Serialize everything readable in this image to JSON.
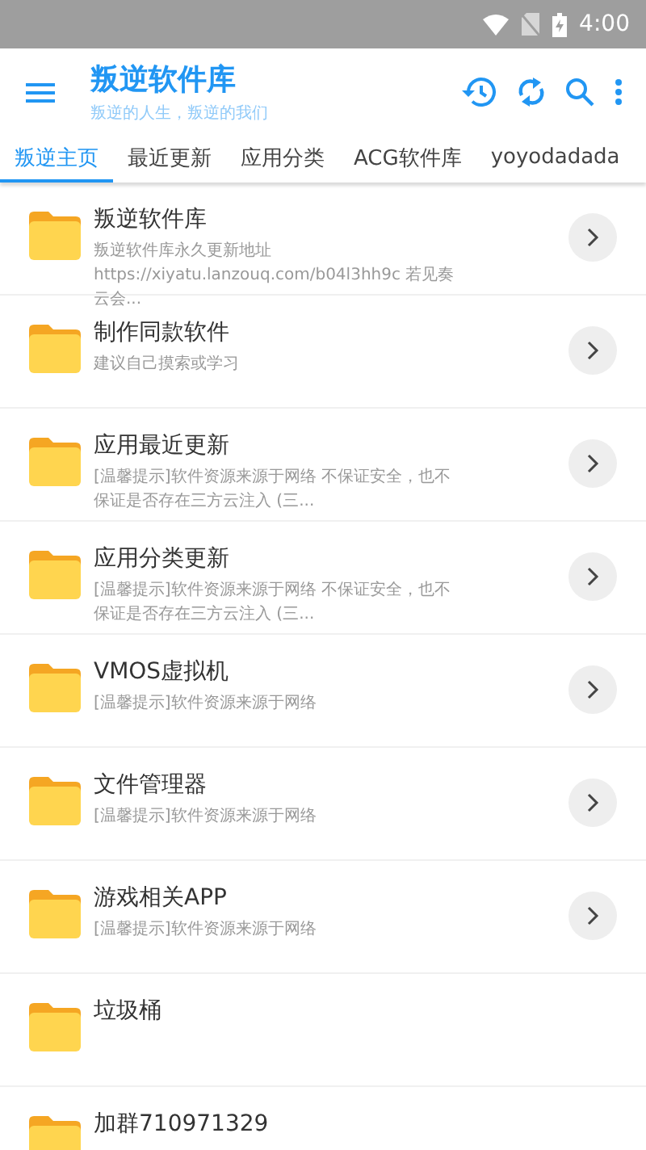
{
  "status_bar": {
    "time": "4:00"
  },
  "app_bar": {
    "title": "叛逆软件库",
    "subtitle": "叛逆的人生，叛逆的我们"
  },
  "tabs": [
    {
      "label": "叛逆主页",
      "selected": true
    },
    {
      "label": "最近更新",
      "selected": false
    },
    {
      "label": "应用分类",
      "selected": false
    },
    {
      "label": "ACG软件库",
      "selected": false
    },
    {
      "label": "yoyodadada",
      "selected": false
    }
  ],
  "items": [
    {
      "title": "叛逆软件库",
      "description": "叛逆软件库永久更新地址\nhttps://xiyatu.lanzouq.com/b04l3hh9c 若见奏云会...",
      "arrow": true
    },
    {
      "title": "制作同款软件",
      "description": "建议自己摸索或学习",
      "arrow": true
    },
    {
      "title": "应用最近更新",
      "description": "[温馨提示]软件资源来源于网络 不保证安全，也不保证是否存在三方云注入 (三...",
      "arrow": true
    },
    {
      "title": "应用分类更新",
      "description": "[温馨提示]软件资源来源于网络 不保证安全，也不保证是否存在三方云注入 (三...",
      "arrow": true
    },
    {
      "title": "VMOS虚拟机",
      "description": "[温馨提示]软件资源来源于网络",
      "arrow": true
    },
    {
      "title": "文件管理器",
      "description": "[温馨提示]软件资源来源于网络",
      "arrow": true
    },
    {
      "title": "游戏相关APP",
      "description": "[温馨提示]软件资源来源于网络",
      "arrow": true
    },
    {
      "title": "垃圾桶",
      "arrow": false
    },
    {
      "title": "加群710971329",
      "arrow": false
    }
  ]
}
